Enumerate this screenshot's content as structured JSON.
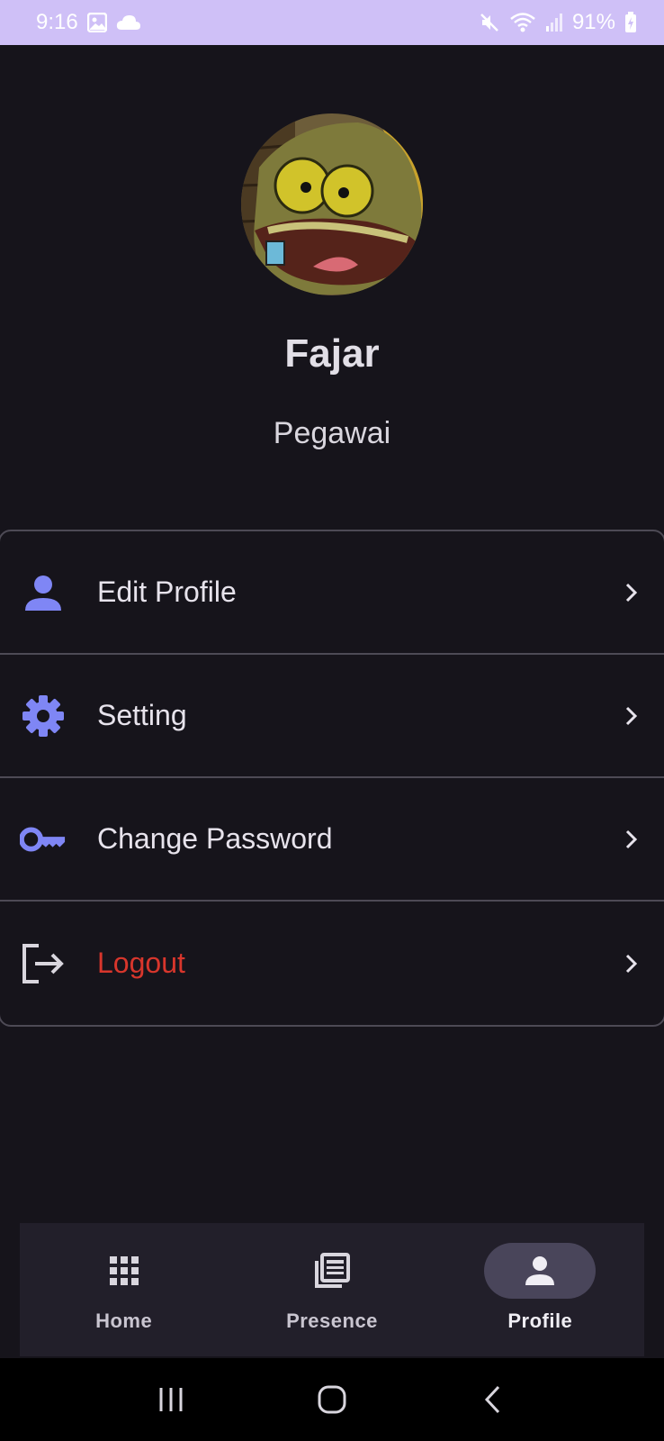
{
  "status_bar": {
    "time": "9:16",
    "battery": "91%"
  },
  "profile": {
    "name": "Fajar",
    "role": "Pegawai"
  },
  "menu": {
    "items": [
      {
        "label": "Edit Profile",
        "icon": "person-icon"
      },
      {
        "label": "Setting",
        "icon": "gear-icon"
      },
      {
        "label": "Change Password",
        "icon": "key-icon"
      },
      {
        "label": "Logout",
        "icon": "logout-icon"
      }
    ]
  },
  "bottom_nav": {
    "items": [
      {
        "label": "Home",
        "icon": "grid-icon",
        "active": false
      },
      {
        "label": "Presence",
        "icon": "news-icon",
        "active": false
      },
      {
        "label": "Profile",
        "icon": "person-icon",
        "active": true
      }
    ]
  },
  "colors": {
    "background": "#16141b",
    "accent_icon": "#7f86f5",
    "logout": "#d8362c",
    "status_bar": "#cfc0f7",
    "nav_background": "#221f2a",
    "nav_active_pill": "#49455a"
  }
}
